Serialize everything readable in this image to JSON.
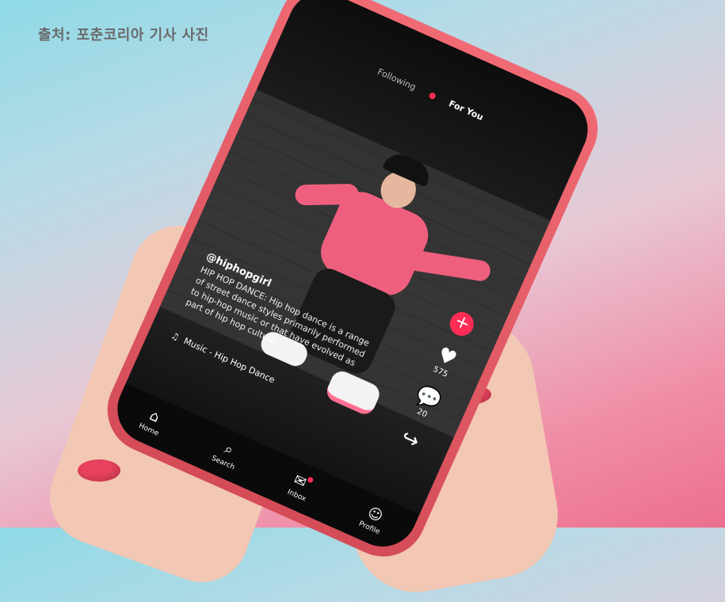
{
  "caption": "출처: 포춘코리아 기사 사진",
  "app": {
    "tabs": {
      "following": "Following",
      "for_you": "For You"
    },
    "post": {
      "handle": "@hiphopgirl",
      "description": "HIP HOP DANCE: Hip hop dance is a range of street dance styles primarily performed to hip-hop music or that have evolved as part of hip hop culture.",
      "music": "Music - Hip Hop Dance"
    },
    "rail": {
      "likes": "575",
      "comments": "20"
    },
    "nav": [
      "Home",
      "Search",
      "Inbox",
      "Profile"
    ]
  },
  "colors": {
    "accent": "#ff2d55",
    "phone": "#e85a66",
    "nail": "#e8425e"
  },
  "icons": {
    "plus": "plus-icon",
    "heart": "heart-icon",
    "comment": "comment-icon",
    "share": "share-icon",
    "home": "home-icon",
    "search": "search-icon",
    "inbox": "inbox-icon",
    "profile": "profile-icon",
    "music": "music-note-icon"
  }
}
